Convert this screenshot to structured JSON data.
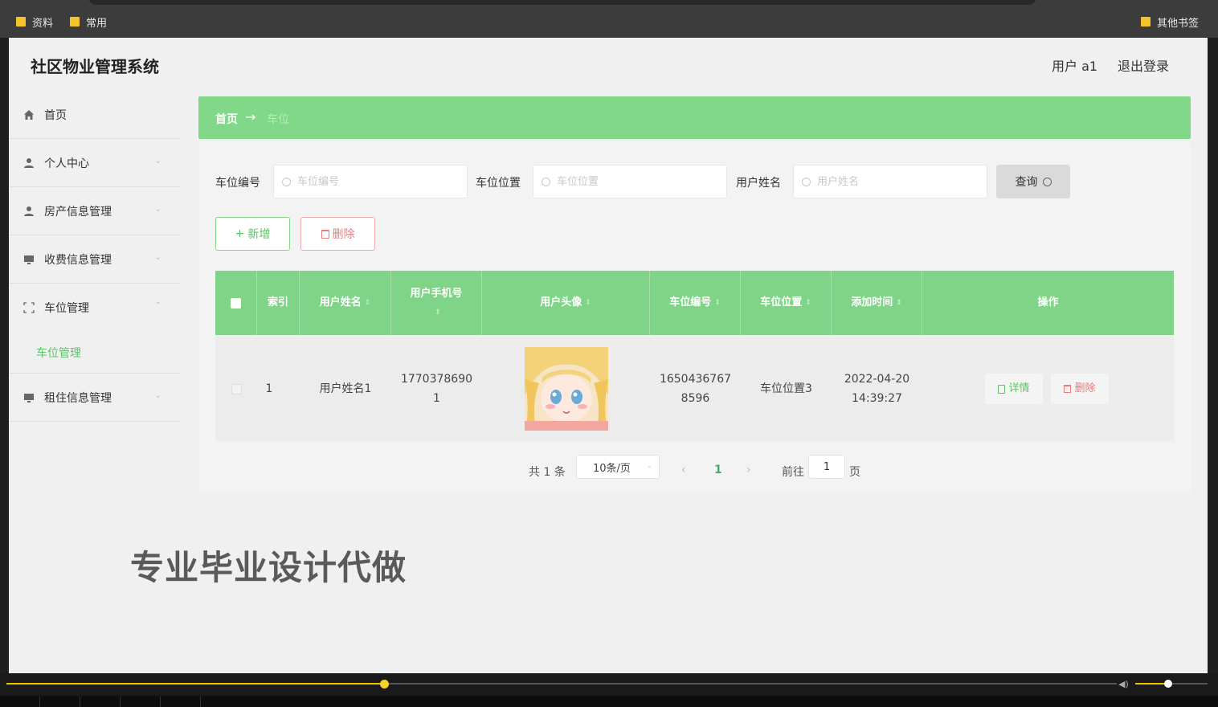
{
  "browser": {
    "bookmarks": [
      "资料",
      "常用"
    ],
    "other_bookmarks": "其他书签"
  },
  "header": {
    "title": "社区物业管理系统",
    "user": "用户 a1",
    "logout": "退出登录"
  },
  "sidebar": {
    "items": [
      {
        "label": "首页",
        "icon": "home-icon"
      },
      {
        "label": "个人中心",
        "icon": "user-icon"
      },
      {
        "label": "房产信息管理",
        "icon": "user-icon"
      },
      {
        "label": "收费信息管理",
        "icon": "monitor-icon"
      },
      {
        "label": "车位管理",
        "icon": "frame-icon",
        "expanded": true
      },
      {
        "label": "租住信息管理",
        "icon": "monitor-icon"
      }
    ],
    "submenu_active": "车位管理"
  },
  "breadcrumb": {
    "home": "首页",
    "current": "车位"
  },
  "search": {
    "field1_label": "车位编号",
    "field1_placeholder": "车位编号",
    "field2_label": "车位位置",
    "field2_placeholder": "车位位置",
    "field3_label": "用户姓名",
    "field3_placeholder": "用户姓名",
    "query_label": "查询"
  },
  "actions": {
    "add_label": "新增",
    "delete_label": "删除"
  },
  "table": {
    "columns": [
      "索引",
      "用户姓名",
      "用户手机号",
      "用户头像",
      "车位编号",
      "车位位置",
      "添加时间",
      "操作"
    ],
    "rows": [
      {
        "index": "1",
        "name": "用户姓名1",
        "phone_a": "1770378690",
        "phone_b": "1",
        "slot_no_a": "1650436767",
        "slot_no_b": "8596",
        "location": "车位位置3",
        "date": "2022-04-20",
        "time": "14:39:27",
        "detail_label": "详情",
        "delete_label": "删除"
      }
    ]
  },
  "pagination": {
    "total": "共 1 条",
    "page_size": "10条/页",
    "current_page": "1",
    "goto_label": "前往",
    "goto_value": "1",
    "page_suffix": "页"
  },
  "watermark": "专业毕业设计代做",
  "player": {
    "progress_fraction": 0.34,
    "volume_fraction": 0.45
  },
  "colors": {
    "accent_green": "#80d888",
    "delete_red": "#f07a7a",
    "progress_yellow": "#f2c200"
  }
}
